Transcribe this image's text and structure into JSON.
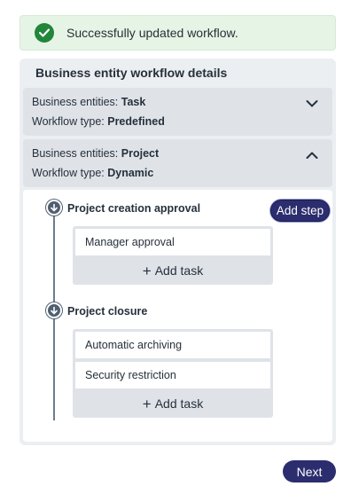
{
  "toast": {
    "message": "Successfully updated workflow.",
    "icon": "check-circle-icon",
    "color": "#22863a"
  },
  "panel": {
    "title": "Business entity workflow details",
    "entities": [
      {
        "entity_label": "Business entities:",
        "entity_value": "Task",
        "type_label": "Workflow type:",
        "type_value": "Predefined",
        "expanded": false
      },
      {
        "entity_label": "Business entities:",
        "entity_value": "Project",
        "type_label": "Workflow type:",
        "type_value": "Dynamic",
        "expanded": true
      }
    ],
    "add_step_label": "Add step",
    "steps": [
      {
        "title": "Project creation approval",
        "tasks": [
          "Manager approval"
        ],
        "add_task_label": "Add task"
      },
      {
        "title": "Project closure",
        "tasks": [
          "Automatic archiving",
          "Security restriction"
        ],
        "add_task_label": "Add task"
      }
    ]
  },
  "footer": {
    "next_label": "Next"
  },
  "colors": {
    "accent": "#2b2d6e",
    "success_bg": "#e6f4e6"
  }
}
